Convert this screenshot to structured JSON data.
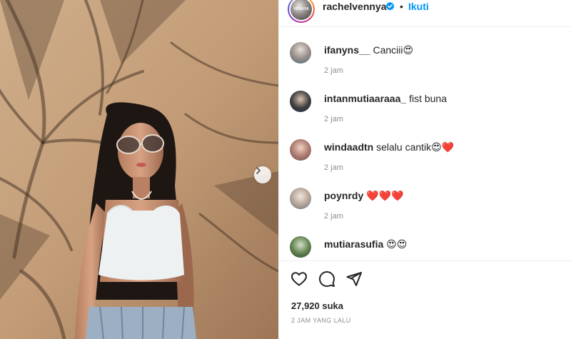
{
  "post": {
    "username": "rachelvennya",
    "avatar_text": "VENNYA",
    "follow_label": "Ikuti",
    "separator": "•",
    "likes_text": "27,920 suka",
    "posted_ago": "2 JAM YANG LALU"
  },
  "comments": [
    {
      "username": "ifanyns__",
      "text": "Canciii😍",
      "time": "2 jam"
    },
    {
      "username": "intanmutiaaraaa_",
      "text": "fist buna",
      "time": "2 jam"
    },
    {
      "username": "windaadtn",
      "text": "selalu cantik😍❤️",
      "time": "2 jam"
    },
    {
      "username": "poynrdy",
      "text": "❤️❤️❤️",
      "time": "2 jam"
    },
    {
      "username": "mutiarasufia",
      "text": "😍😍",
      "time": ""
    }
  ],
  "icons": {
    "verified": "verified-badge-icon",
    "next": "chevron-right-icon",
    "like": "heart-outline-icon",
    "comment": "comment-bubble-icon",
    "share": "paper-plane-icon"
  },
  "colors": {
    "follow": "#0095f6",
    "verified": "#0095f6",
    "muted": "#8e8e8e"
  }
}
